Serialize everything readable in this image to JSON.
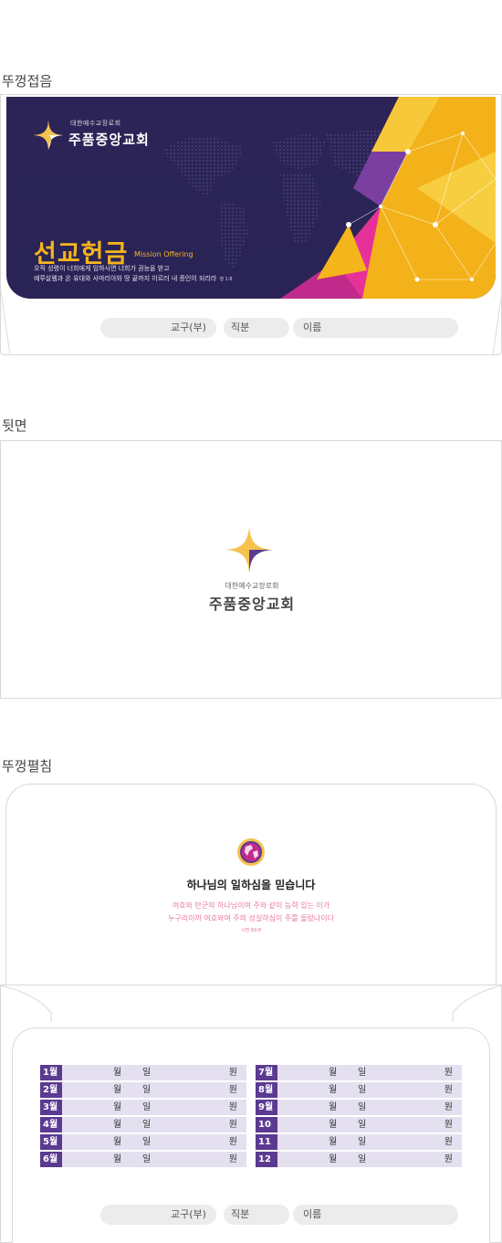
{
  "sections": {
    "front": "뚜껑접음",
    "back": "뒷면",
    "open": "뚜껑펼침"
  },
  "brand": {
    "small": "대한예수교장로회",
    "name": "주품중앙교회"
  },
  "front_cover": {
    "title": "선교헌금",
    "subtitle": "Mission Offering",
    "verse_line1": "오직 성령이 너희에게 임하시면 너희가 권능을 받고",
    "verse_line2": "예루살렘과 온 유대와 사마리아와 땅 끝까지 이르러 내 증인이 되리라",
    "verse_ref": "행 1:8"
  },
  "fields": {
    "group": "교구(부)",
    "position": "직분",
    "name": "이름"
  },
  "open_flap": {
    "title": "하나님의 일하심을 믿습니다",
    "verse_line1": "여호와 만군의 하나님이여 주와 같이 능력 있는 이가",
    "verse_line2": "누구리이까 여호와여 주의 성실하심이 주를 둘렀나이다",
    "verse_ref": "시편 89:8"
  },
  "units": {
    "month": "월",
    "day": "일",
    "won": "원"
  },
  "months_left": [
    "1월",
    "2월",
    "3월",
    "4월",
    "5월",
    "6월"
  ],
  "months_right": [
    "7월",
    "8월",
    "9월",
    "10월",
    "11월",
    "12월"
  ],
  "colors": {
    "navy": "#2c2457",
    "gold": "#f5b51c",
    "purple": "#5b3a91",
    "pink": "#e8789c"
  }
}
